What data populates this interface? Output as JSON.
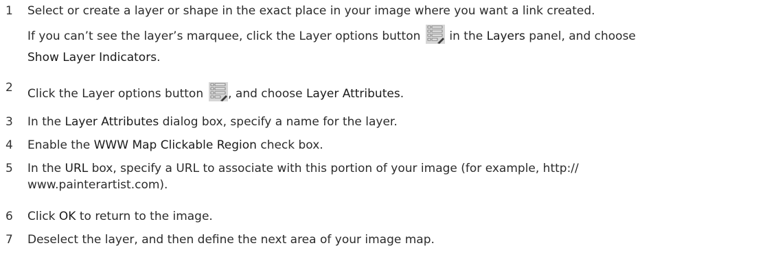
{
  "steps": [
    {
      "number": "1",
      "text": "Select or create a layer or shape in the exact place in your image where you want a link created.",
      "note": {
        "part1": "If you can’t see the layer’s marquee, click the Layer options button",
        "part2": "in the",
        "term1": "Layers",
        "part3": "panel, and choose",
        "term2": "Show Layer Indicators",
        "end": "."
      }
    },
    {
      "number": "2",
      "part1": "Click the Layer options button",
      "part2": ", and choose",
      "term": "Layer Attributes",
      "end": "."
    },
    {
      "number": "3",
      "part1": "In the",
      "term": "Layer Attributes",
      "part2": "dialog box, specify a name for the layer."
    },
    {
      "number": "4",
      "part1": "Enable the",
      "term": "WWW Map Clickable Region",
      "part2": "check box."
    },
    {
      "number": "5",
      "part1": "In the",
      "term": "URL",
      "part2": "box, specify a URL to associate with this portion of your image (for example, http://",
      "line2": "www.painterartist.com)."
    },
    {
      "number": "6",
      "part1": "Click",
      "term": "OK",
      "part2": "to return to the image."
    },
    {
      "number": "7",
      "text": "Deselect the layer, and then define the next area of your image map."
    }
  ],
  "icon_colors": {
    "background": "#d6d6d6",
    "bars": "#6b6b6b",
    "bar_fill": "#f2f2f2",
    "pencil": "#3a3a3a"
  }
}
